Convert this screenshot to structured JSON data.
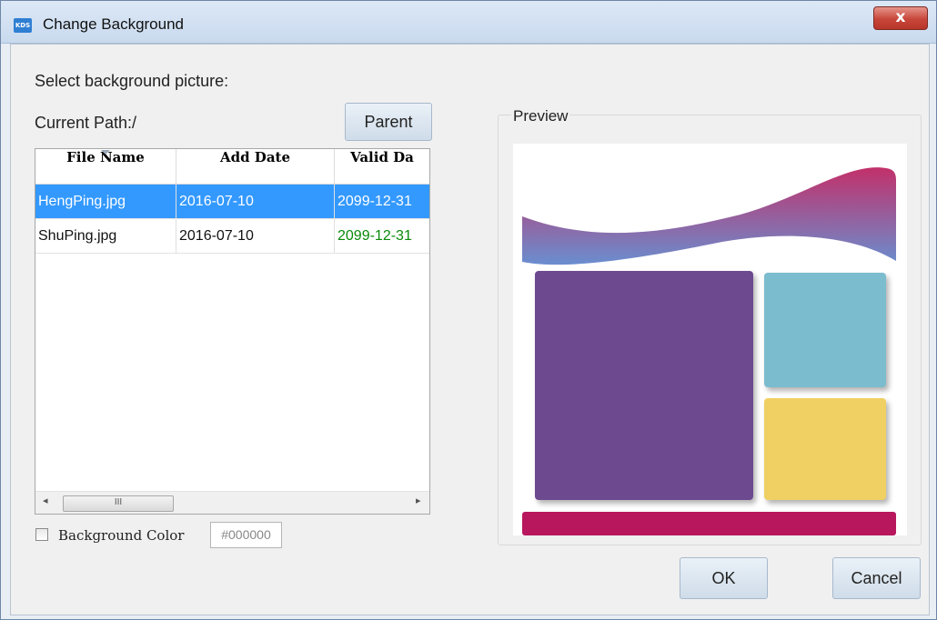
{
  "window": {
    "title": "Change Background",
    "app_icon": "app-icon",
    "app_icon_text": "KDS",
    "close_glyph": "x"
  },
  "left": {
    "select_label": "Select background picture:",
    "path_label": "Current Path:/",
    "parent_button": "Parent"
  },
  "table": {
    "columns": [
      "File Name",
      "Add Date",
      "Valid Da"
    ],
    "rows": [
      {
        "name": "HengPing.jpg",
        "add_date": "2016-07-10",
        "valid_date": "2099-12-31",
        "selected": true
      },
      {
        "name": "ShuPing.jpg",
        "add_date": "2016-07-10",
        "valid_date": "2099-12-31",
        "selected": false
      }
    ],
    "scroll_thumb_grip": "III",
    "scroll_left_glyph": "◂",
    "scroll_right_glyph": "▸"
  },
  "background_color": {
    "label": "Background Color",
    "checked": false,
    "value": "#000000"
  },
  "preview": {
    "title": "Preview",
    "colors": {
      "wave_top": "#c2306a",
      "wave_bottom": "#6a8ecf",
      "purple": "#6d4a8f",
      "blue": "#7cbccf",
      "yellow": "#f0d062",
      "strip": "#b8175e"
    }
  },
  "buttons": {
    "ok": "OK",
    "cancel": "Cancel"
  },
  "colors": {
    "selection": "#3399ff",
    "valid_date_green": "#0a8a0a"
  }
}
